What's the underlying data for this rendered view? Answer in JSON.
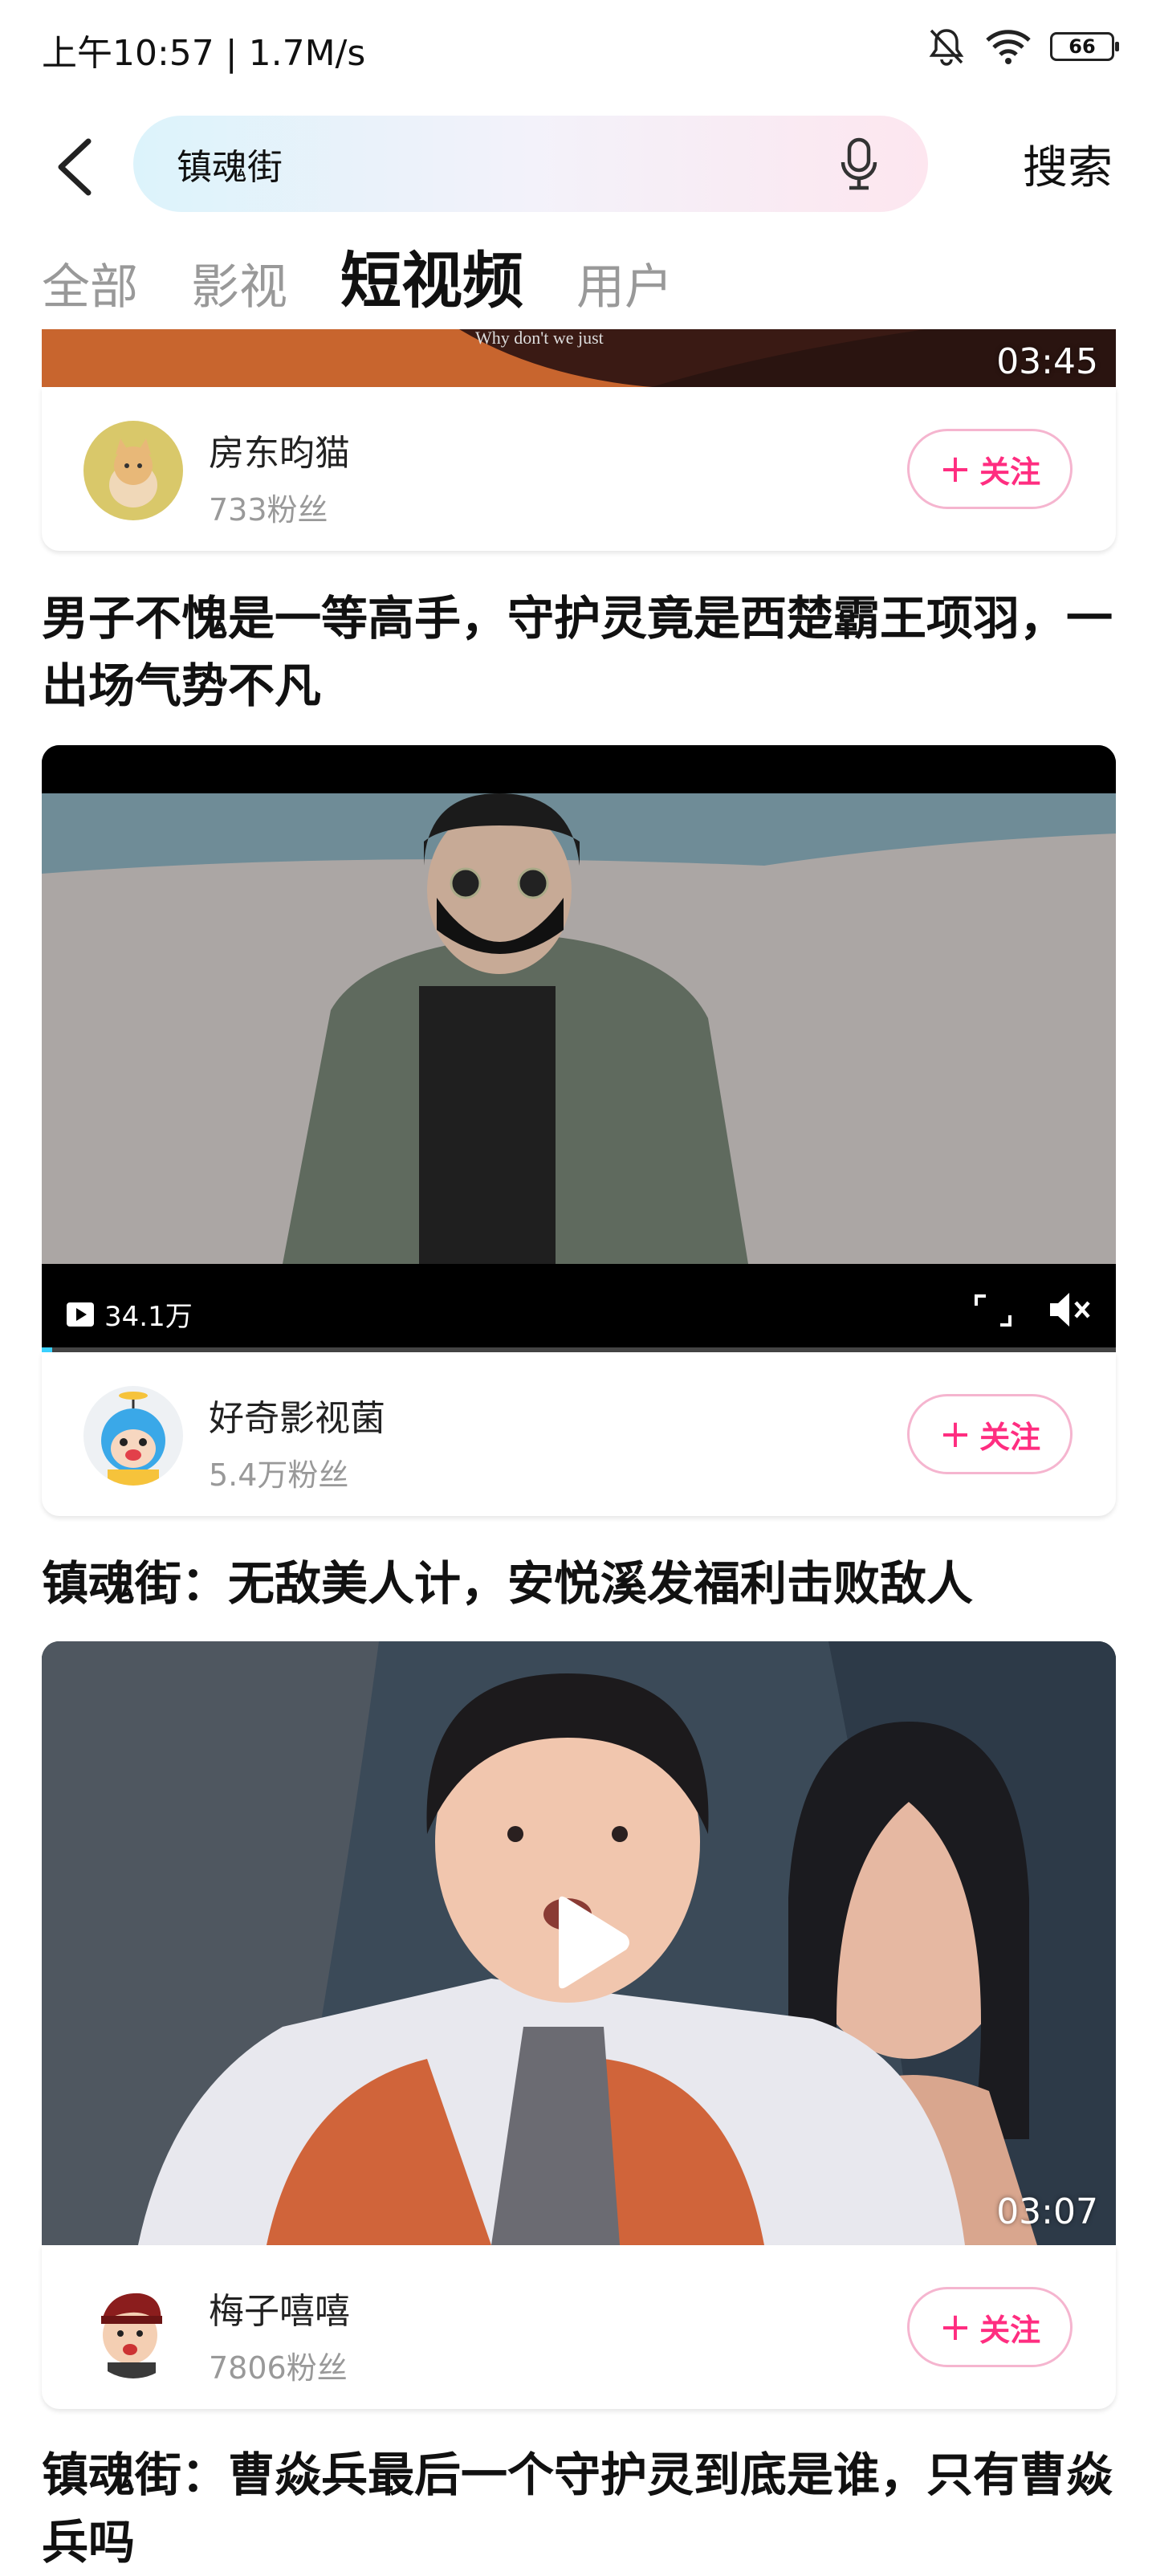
{
  "status_bar": {
    "time": "上午10:57 | 1.7M/s",
    "battery": "66"
  },
  "search": {
    "query": "镇魂街",
    "button_label": "搜索"
  },
  "tabs": [
    {
      "label": "全部",
      "active": false
    },
    {
      "label": "影视",
      "active": false
    },
    {
      "label": "短视频",
      "active": true
    },
    {
      "label": "用户",
      "active": false
    }
  ],
  "results": [
    {
      "video": {
        "duration": "03:45",
        "subtitle": "Why don't we just"
      },
      "author": {
        "name": "房东昀猫",
        "fans": "733粉丝"
      },
      "follow_label": "关注"
    },
    {
      "title": "男子不愧是一等高手，守护灵竟是西楚霸王项羽，一出场气势不凡",
      "video": {
        "views": "34.1万",
        "progress": 0.01
      },
      "author": {
        "name": "好奇影视菌",
        "fans": "5.4万粉丝"
      },
      "follow_label": "关注"
    },
    {
      "title": "镇魂街：无敌美人计，安悦溪发福利击败敌人",
      "video": {
        "duration": "03:07"
      },
      "author": {
        "name": "梅子嘻嘻",
        "fans": "7806粉丝"
      },
      "follow_label": "关注"
    },
    {
      "title": "镇魂街：曹焱兵最后一个守护灵到底是谁，只有曹焱兵吗"
    }
  ],
  "colors": {
    "accent": "#ff2d80",
    "follow_border": "#f5b5cf",
    "progress": "#3ad1ff"
  }
}
